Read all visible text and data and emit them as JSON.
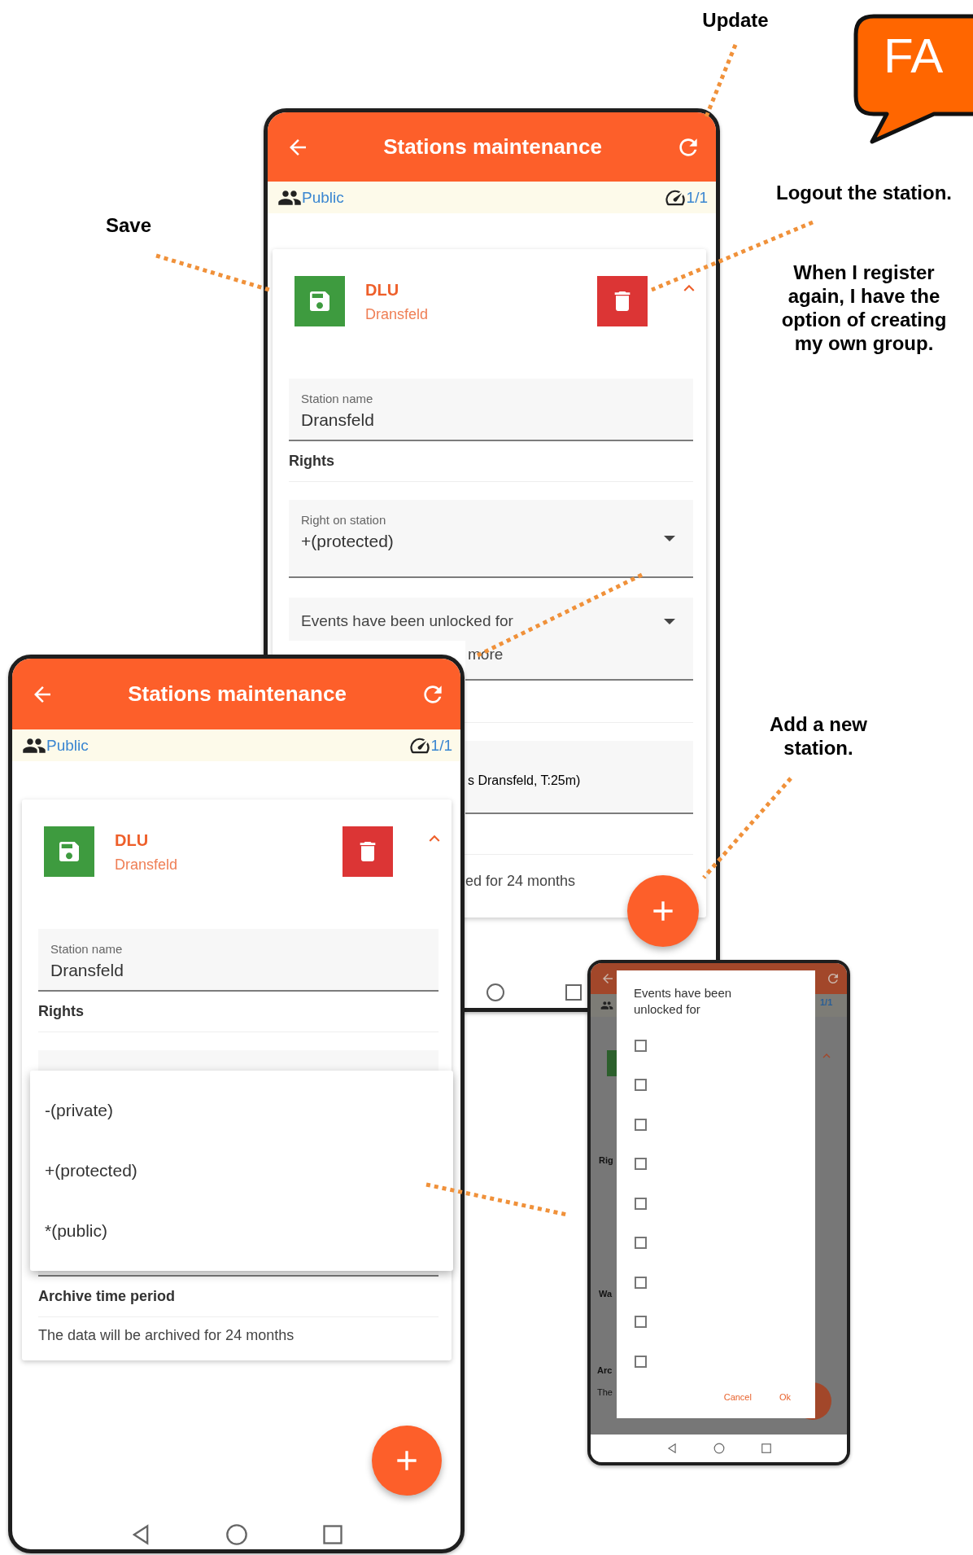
{
  "faq_badge": {
    "text": "FA"
  },
  "annotations": [
    {
      "text": "Update"
    },
    {
      "text": "Save"
    },
    {
      "text": "Logout the station."
    },
    {
      "text": "When I register again, I have the option of creating my own group."
    },
    {
      "text": "Add a new station."
    }
  ],
  "back_screen": {
    "title": "Stations maintenance",
    "group": "Public",
    "counter": "1/1",
    "station": {
      "code": "DLU",
      "name": "Dransfeld",
      "expanded": true
    },
    "name_field": {
      "label": "Station name",
      "value": "Dransfeld"
    },
    "rights_heading": "Rights",
    "right_field": {
      "label": "Right on station",
      "value": "+(protected)"
    },
    "events_field": {
      "label": "Events have been unlocked for",
      "value_tail": "more"
    },
    "location_tail": "s Dransfeld, T:25m)",
    "archive_tail": "ed for 24 months"
  },
  "front_screen": {
    "title": "Stations maintenance",
    "group": "Public",
    "counter": "1/1",
    "station": {
      "code": "DLU",
      "name": "Dransfeld",
      "expanded": true
    },
    "name_field": {
      "label": "Station name",
      "value": "Dransfeld"
    },
    "rights_heading": "Rights",
    "menu_options": [
      {
        "label": "-(private)"
      },
      {
        "label": "+(protected)"
      },
      {
        "label": "*(public)"
      }
    ],
    "archive_heading": "Archive time period",
    "archive_text": "The data will be archived for 24 months"
  },
  "dialog_screen": {
    "counter": "1/1",
    "fragments": [
      {
        "text": "Rig"
      },
      {
        "text": "Wa"
      },
      {
        "text": "Arc"
      },
      {
        "text": "The"
      }
    ],
    "dialog": {
      "title": "Events have been unlocked for",
      "options": [
        {
          "checked": false
        },
        {
          "checked": false
        },
        {
          "checked": false
        },
        {
          "checked": false
        },
        {
          "checked": false
        },
        {
          "checked": false
        },
        {
          "checked": false
        },
        {
          "checked": false
        },
        {
          "checked": false
        }
      ],
      "buttons": [
        "Cancel",
        "Ok"
      ]
    }
  }
}
